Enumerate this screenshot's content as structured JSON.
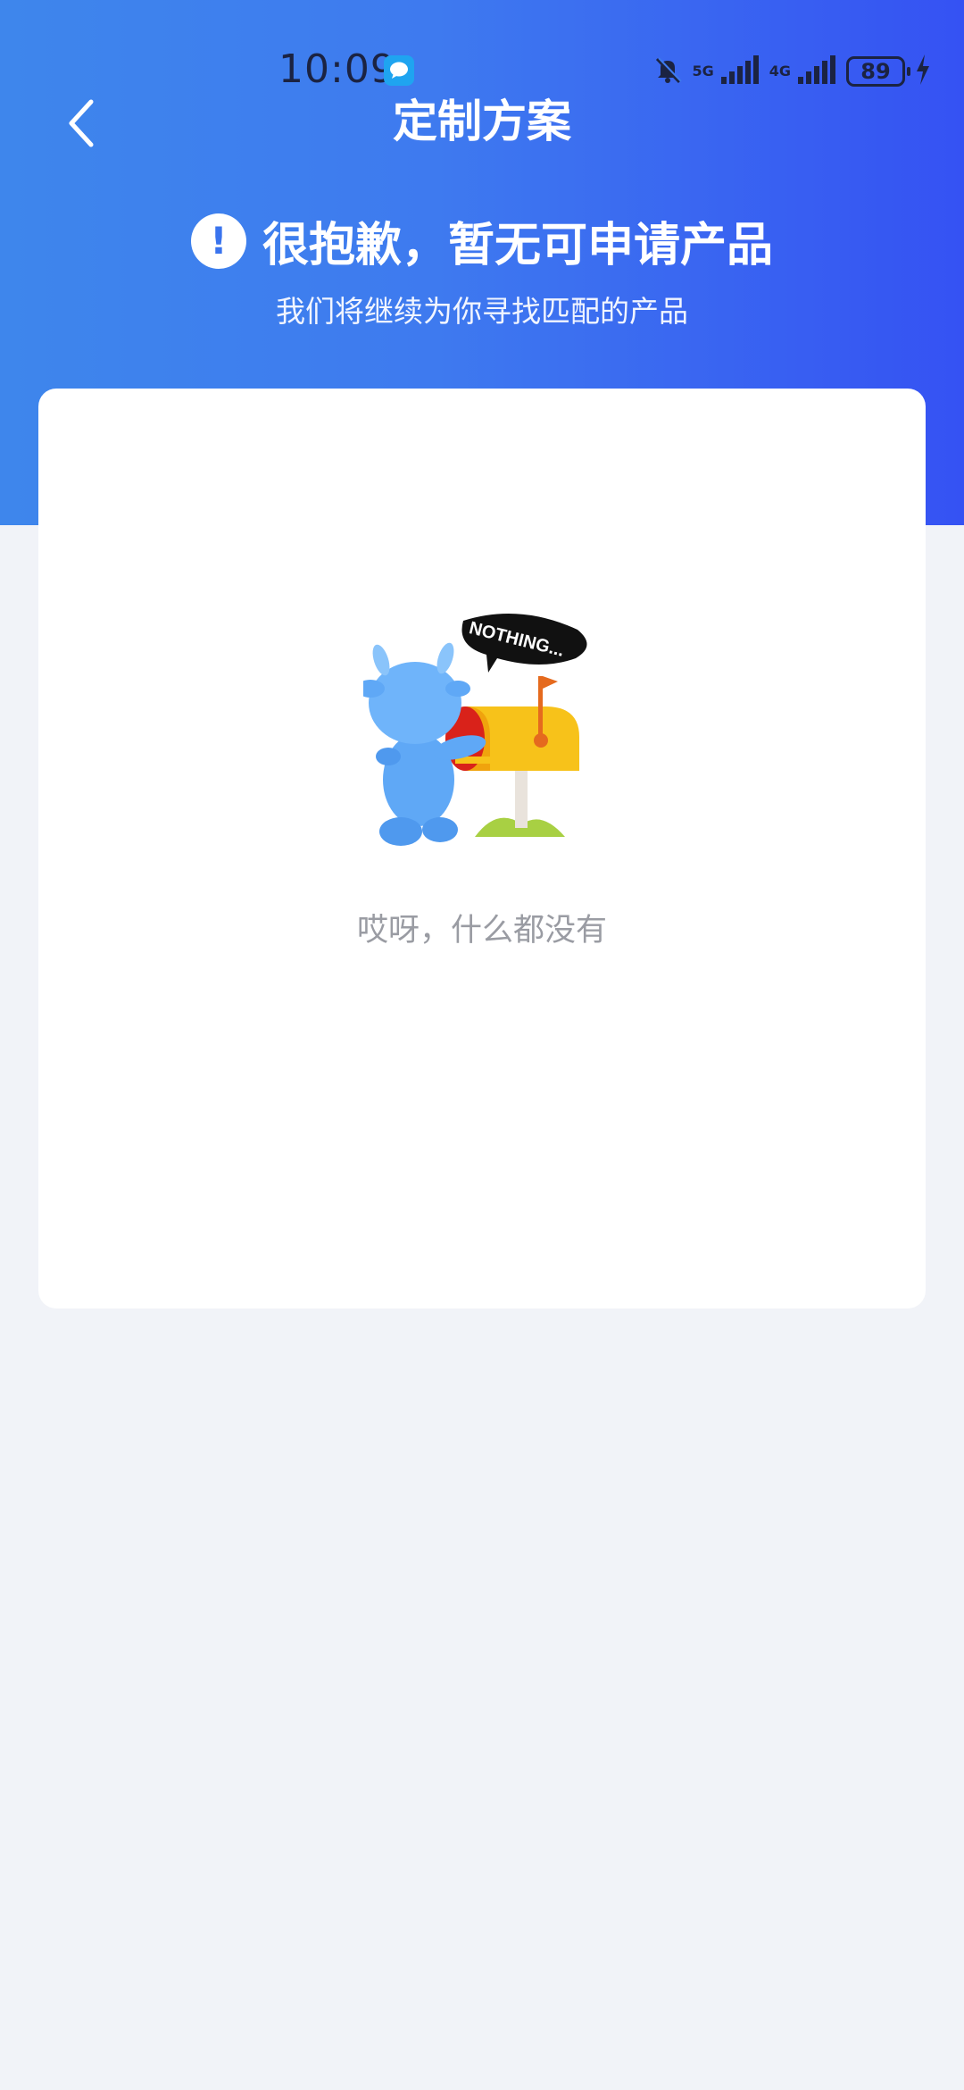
{
  "status_bar": {
    "time": "10:09",
    "network_5g": "5G",
    "network_4g": "4G",
    "battery": "89"
  },
  "nav": {
    "title": "定制方案"
  },
  "notice": {
    "title": "很抱歉，暂无可申请产品",
    "subtitle": "我们将继续为你寻找匹配的产品"
  },
  "empty_state": {
    "illustration_text": "NOTHING...",
    "message": "哎呀，什么都没有"
  },
  "colors": {
    "header_start": "#3e86ec",
    "header_end": "#3552f3",
    "page_bg": "#f1f3f8",
    "card_bg": "#ffffff"
  }
}
